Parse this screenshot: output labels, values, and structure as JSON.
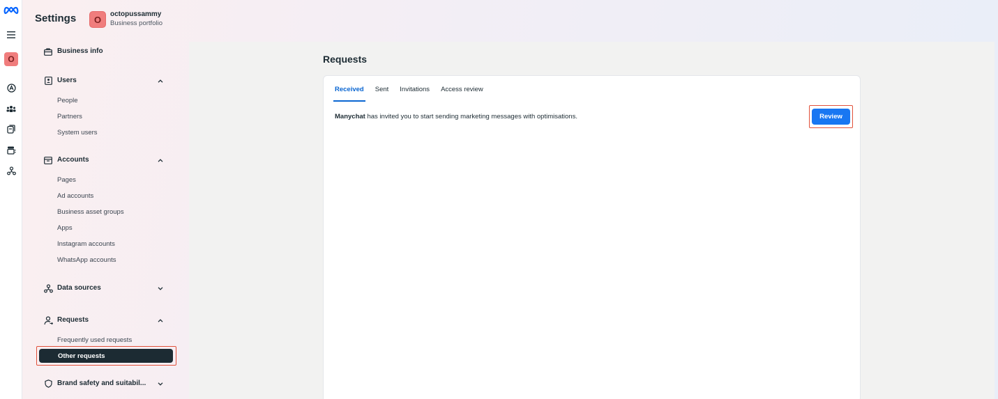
{
  "header": {
    "title": "Settings",
    "portfolio_initial": "O",
    "portfolio_name": "octopussammy",
    "portfolio_type": "Business portfolio"
  },
  "rail": {
    "avatar_initial": "O",
    "icons": [
      "meta-logo-icon",
      "menu-icon",
      "ads-icon",
      "people-icon",
      "pages-icon",
      "inbox-icon",
      "network-icon"
    ]
  },
  "sidebar": {
    "business_info": "Business info",
    "users": {
      "label": "Users",
      "items": [
        "People",
        "Partners",
        "System users"
      ]
    },
    "accounts": {
      "label": "Accounts",
      "items": [
        "Pages",
        "Ad accounts",
        "Business asset groups",
        "Apps",
        "Instagram accounts",
        "WhatsApp accounts"
      ]
    },
    "data_sources": {
      "label": "Data sources"
    },
    "requests": {
      "label": "Requests",
      "items": [
        "Frequently used requests",
        "Other requests"
      ],
      "active": "Other requests"
    },
    "brand_safety": {
      "label": "Brand safety and suitabil..."
    }
  },
  "main": {
    "title": "Requests",
    "tabs": [
      "Received",
      "Sent",
      "Invitations",
      "Access review"
    ],
    "active_tab": "Received",
    "request": {
      "sender": "Manychat",
      "text": " has invited you to start sending marketing messages with optimisations.",
      "action_label": "Review"
    }
  },
  "colors": {
    "accent": "#1877f2",
    "active_tab": "#0a66d2",
    "active_nav_bg": "#1c2b33",
    "avatar_bg": "#f07d7d",
    "highlight": "#e0503a"
  }
}
